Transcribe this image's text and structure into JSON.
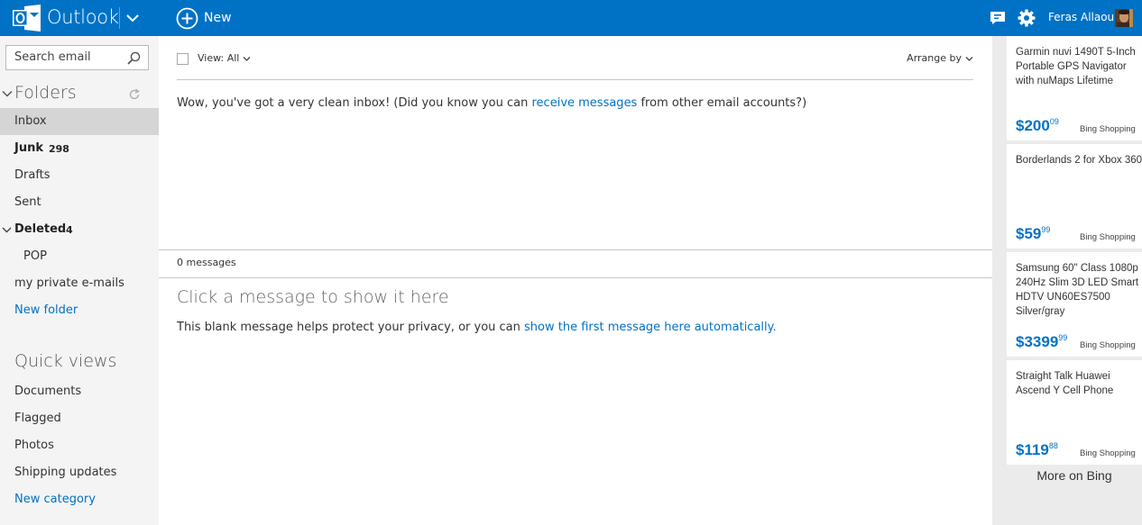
{
  "header": {
    "app_title": "Outlook",
    "new_label": "New",
    "user_name": "Feras Allaou",
    "colors": {
      "bar": "#0072c6",
      "text": "#ffffff"
    }
  },
  "sidebar": {
    "search_placeholder": "Search email",
    "folders_heading": "Folders",
    "folders": [
      {
        "label": "Inbox",
        "count": "",
        "selected": true
      },
      {
        "label": "Junk",
        "count": "298",
        "bold": true
      },
      {
        "label": "Drafts",
        "count": ""
      },
      {
        "label": "Sent",
        "count": ""
      },
      {
        "label": "Deleted",
        "count": "4",
        "bold": true,
        "expanded": true
      },
      {
        "label": "POP",
        "count": "",
        "child": true
      },
      {
        "label": "my private e-mails",
        "count": ""
      },
      {
        "label": "New folder",
        "link": true
      }
    ],
    "quick_views_heading": "Quick views",
    "quick_views": [
      {
        "label": "Documents"
      },
      {
        "label": "Flagged"
      },
      {
        "label": "Photos"
      },
      {
        "label": "Shipping updates"
      },
      {
        "label": "New category",
        "link": true
      }
    ]
  },
  "main": {
    "view_label": "View: All",
    "arrange_label": "Arrange by",
    "clean_message_pre": "Wow, you've got a very clean inbox! (Did you know you can ",
    "clean_message_link": "receive messages",
    "clean_message_post": " from other email accounts?)",
    "message_count": "0 messages",
    "reading_title": "Click a message to show it here",
    "reading_body_pre": "This blank message helps protect your privacy, or you can ",
    "reading_body_link": "show the first message here automatically."
  },
  "ads": {
    "items": [
      {
        "title": "Garmin nuvi 1490T 5-Inch Portable GPS Navigator with nuMaps Lifetime",
        "price_main": "$200",
        "price_cents": "09",
        "source": "Bing Shopping"
      },
      {
        "title": "Borderlands 2 for Xbox 360",
        "price_main": "$59",
        "price_cents": "99",
        "source": "Bing Shopping"
      },
      {
        "title": "Samsung 60\" Class 1080p 240Hz Slim 3D LED Smart HDTV UN60ES7500 Silver/gray",
        "price_main": "$3399",
        "price_cents": "99",
        "source": "Bing Shopping"
      },
      {
        "title": "Straight Talk Huawei Ascend Y Cell Phone",
        "price_main": "$119",
        "price_cents": "88",
        "source": "Bing Shopping"
      }
    ],
    "more_label": "More on Bing"
  }
}
